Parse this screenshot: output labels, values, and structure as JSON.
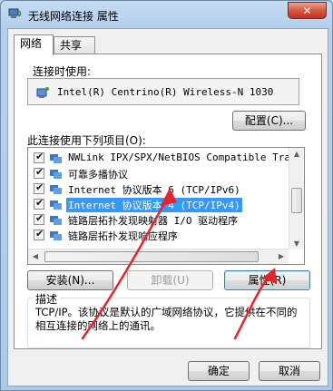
{
  "window": {
    "title": "无线网络连接 属性",
    "close_label": "✕"
  },
  "tabs": [
    {
      "label": "网络",
      "active": true
    },
    {
      "label": "共享",
      "active": false
    }
  ],
  "connect_using": {
    "label": "连接时使用:",
    "adapter": "Intel(R) Centrino(R) Wireless-N 1030",
    "configure_button": "配置(C)..."
  },
  "items_section": {
    "label": "此连接使用下列项目(O):",
    "items": [
      {
        "label": "NWLink IPX/SPX/NetBIOS Compatible Transpor",
        "checked": true,
        "selected": false,
        "icon": "protocol-icon"
      },
      {
        "label": "可靠多播协议",
        "checked": true,
        "selected": false,
        "icon": "protocol-icon"
      },
      {
        "label": "Internet 协议版本 6 (TCP/IPv6)",
        "checked": true,
        "selected": false,
        "icon": "protocol-icon"
      },
      {
        "label": "Internet 协议版本 4 (TCP/IPv4)",
        "checked": true,
        "selected": true,
        "icon": "protocol-icon"
      },
      {
        "label": "链路层拓扑发现映射器 I/O 驱动程序",
        "checked": true,
        "selected": false,
        "icon": "protocol-icon"
      },
      {
        "label": "链路层拓扑发现响应程序",
        "checked": true,
        "selected": false,
        "icon": "protocol-icon"
      }
    ]
  },
  "buttons": {
    "install": "安装(N)...",
    "uninstall": "卸载(U)",
    "properties": "属性(R)",
    "ok": "确定",
    "cancel": "取消"
  },
  "description": {
    "title": "描述",
    "text": "TCP/IP。该协议是默认的广域网络协议，它提供在不同的相互连接的网络上的通讯。"
  },
  "colors": {
    "selection": "#3399ff",
    "annotation_arrow": "#e8242b"
  }
}
